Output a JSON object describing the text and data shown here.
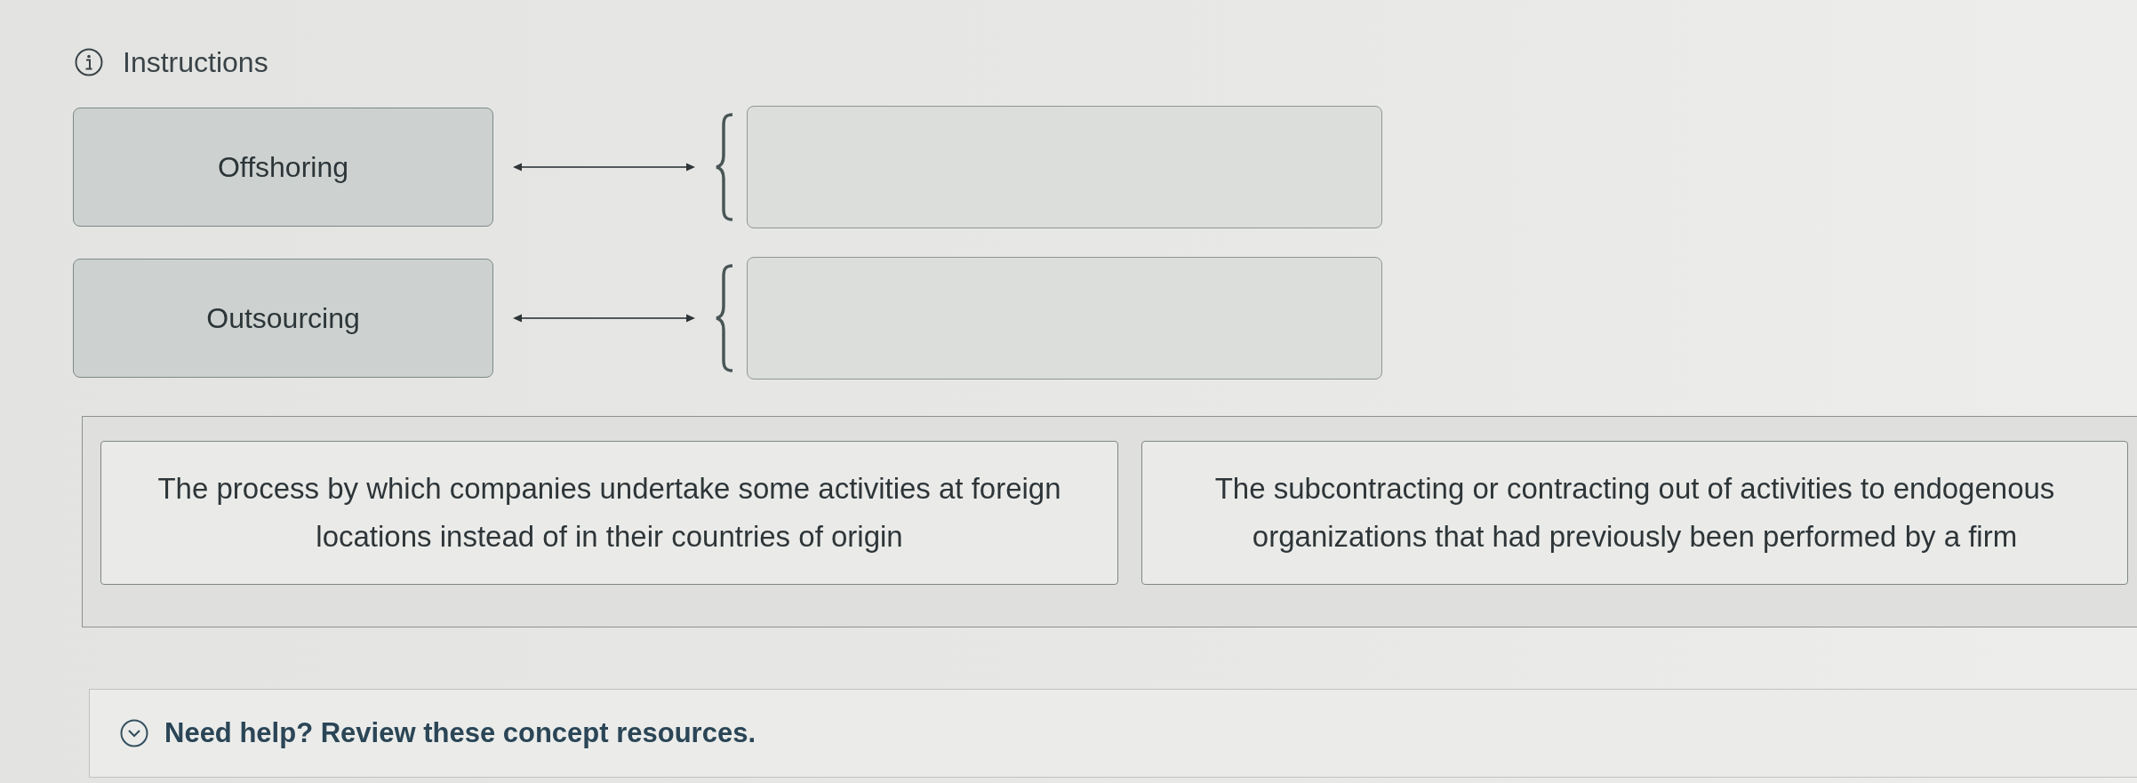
{
  "instructions": {
    "label": "Instructions"
  },
  "matching": {
    "rows": [
      {
        "term": "Offshoring"
      },
      {
        "term": "Outsourcing"
      }
    ]
  },
  "answer_bank": {
    "items": [
      {
        "text": "The process by which companies undertake some activities at foreign locations instead of in their countries of origin"
      },
      {
        "text": "The subcontracting or contracting out of activities to endogenous organizations that had previously been performed by a firm"
      }
    ]
  },
  "help": {
    "label": "Need help? Review these concept resources.",
    "expanded": false
  }
}
